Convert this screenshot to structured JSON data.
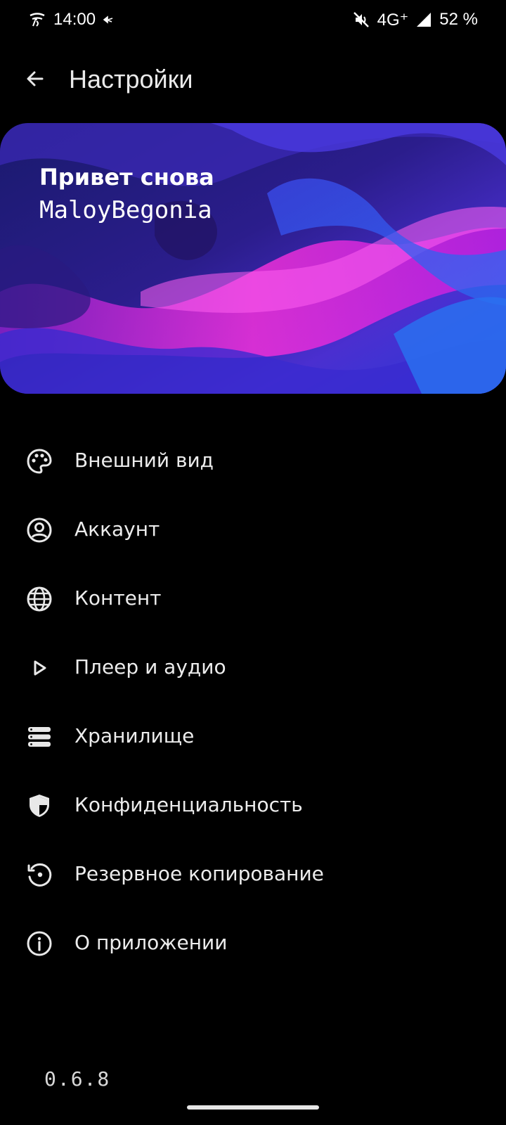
{
  "status_bar": {
    "time": "14:00",
    "network": "4G⁺",
    "battery": "52 %",
    "icons": [
      "notification-app-icon",
      "notification-small-icon",
      "mute-icon",
      "signal-icon"
    ]
  },
  "header": {
    "title": "Настройки",
    "back_icon": "arrow-left-icon"
  },
  "hero": {
    "greeting": "Привет снова",
    "username": "MaloyBegonia"
  },
  "menu": {
    "items": [
      {
        "label": "Внешний вид",
        "icon": "palette-icon"
      },
      {
        "label": "Аккаунт",
        "icon": "account-circle-icon"
      },
      {
        "label": "Контент",
        "icon": "globe-icon"
      },
      {
        "label": "Плеер и аудио",
        "icon": "play-icon"
      },
      {
        "label": "Хранилище",
        "icon": "storage-icon"
      },
      {
        "label": "Конфиденциальность",
        "icon": "shield-icon"
      },
      {
        "label": "Резервное копирование",
        "icon": "restore-icon"
      },
      {
        "label": "О приложении",
        "icon": "info-icon"
      }
    ]
  },
  "footer": {
    "version": "0.6.8"
  },
  "colors": {
    "background": "#000000",
    "text": "#ececec",
    "hero_magenta": "#e020d0",
    "hero_blue": "#3a3ae8",
    "hero_dark": "#1a1060"
  }
}
